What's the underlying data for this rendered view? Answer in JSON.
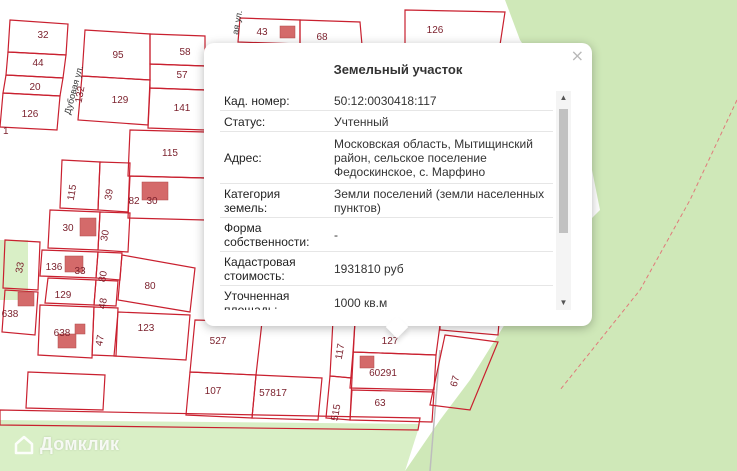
{
  "map": {
    "street_labels": [
      "Дубовая ул.",
      "ая ул."
    ],
    "parcel_labels": [
      "32",
      "44",
      "20",
      "126",
      "95",
      "58",
      "57",
      "132",
      "129",
      "141",
      "43",
      "68",
      "126",
      "115",
      "115",
      "39",
      "82",
      "30",
      "30",
      "30",
      "33",
      "136",
      "33",
      "80",
      "80",
      "129",
      "48",
      "638",
      "638",
      "47",
      "123",
      "527",
      "117",
      "127",
      "60291",
      "67",
      "107",
      "57817",
      "515",
      "63"
    ],
    "partial_label": "1",
    "colors": {
      "parcel_border": "#c9202f",
      "building": "#d46a6a",
      "land_fill": "#ffffff",
      "forest": "#cfe8b8",
      "road": "#bdbdbd"
    }
  },
  "watermark": {
    "text": "Домклик",
    "icon": "home-icon"
  },
  "popup": {
    "title": "Земельный участок",
    "close_label": "×",
    "rows": [
      {
        "key": "Кад. номер:",
        "value": "50:12:0030418:117"
      },
      {
        "key": "Статус:",
        "value": "Учтенный"
      },
      {
        "key": "Адрес:",
        "value": "Московская область, Мытищинский район, сельское поселение Федоскинское, с. Марфино"
      },
      {
        "key": "Категория земель:",
        "value": "Земли поселений (земли населенных пунктов)"
      },
      {
        "key": "Форма собственности:",
        "value": "-"
      },
      {
        "key": "Кадастровая стоимость:",
        "value": "1931810 руб"
      },
      {
        "key": "Уточненная площадь:",
        "value": "1000 кв.м"
      }
    ]
  }
}
